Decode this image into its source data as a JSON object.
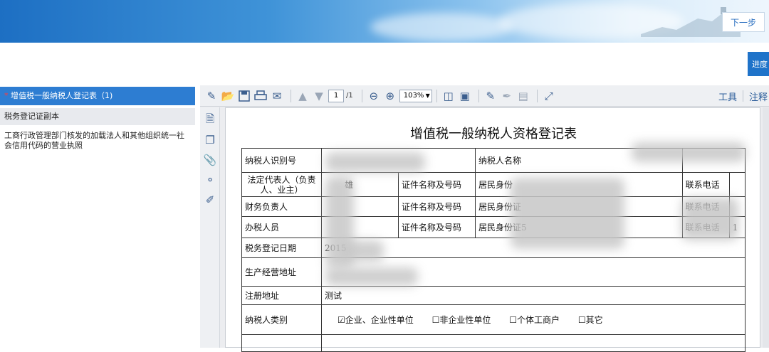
{
  "header": {
    "next_label": "下一步",
    "progress_label": "进度"
  },
  "sidebar": {
    "items": [
      {
        "marker": "*",
        "label": "增值税一般纳税人登记表（1)"
      },
      {
        "label": "税务登记证副本"
      },
      {
        "label": "工商行政管理部门核发的加载法人和其他组织统一社会信用代码的营业执照"
      }
    ]
  },
  "toolbar": {
    "page_current": "1",
    "page_total": "/1",
    "zoom": "103%",
    "tools_label": "工具",
    "comment_label": "注释"
  },
  "document": {
    "title": "增值税一般纳税人资格登记表",
    "labels": {
      "taxpayer_id": "纳税人识别号",
      "taxpayer_name": "纳税人名称",
      "legal_rep": "法定代表人（负责人、业主）",
      "finance_head": "财务负责人",
      "handler": "办税人员",
      "id_doc": "证件名称及号码",
      "phone": "联系电话",
      "reg_date": "税务登记日期",
      "biz_address": "生产经营地址",
      "reg_address": "注册地址",
      "taxpayer_type": "纳税人类别"
    },
    "values": {
      "legal_rep_partial": "雄",
      "legal_rep_doc": "居民身份",
      "finance_doc": "居民身份证",
      "handler_doc": "居民身份证5",
      "handler_phone_partial": "1",
      "reg_date_partial": "2015",
      "reg_address": "测试"
    },
    "types": [
      {
        "checked": "☑",
        "label": "企业、企业性单位"
      },
      {
        "checked": "☐",
        "label": "非企业性单位"
      },
      {
        "checked": "☐",
        "label": "个体工商户"
      },
      {
        "checked": "☐",
        "label": "其它"
      }
    ]
  }
}
